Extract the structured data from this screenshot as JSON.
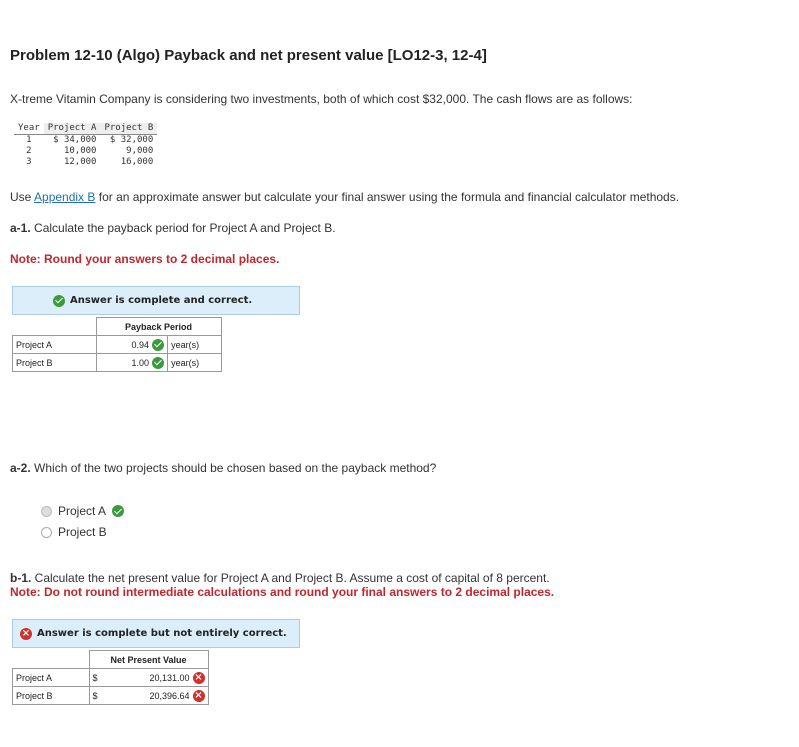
{
  "title": "Problem 12-10 (Algo) Payback and net present value [LO12-3, 12-4]",
  "intro": "X-treme Vitamin Company is considering two investments, both of which cost $32,000. The cash flows are as follows:",
  "cash_flow_table": {
    "headers": [
      "Year",
      "Project A",
      "Project B"
    ],
    "rows": [
      [
        "1",
        "$ 34,000",
        "$ 32,000"
      ],
      [
        "2",
        "10,000",
        "9,000"
      ],
      [
        "3",
        "12,000",
        "16,000"
      ]
    ]
  },
  "instructions": {
    "pre": "Use ",
    "link": "Appendix B",
    "post": " for an approximate answer but calculate your final answer using the formula and financial calculator methods."
  },
  "a1": {
    "label": "a-1.",
    "text": " Calculate the payback period for Project A and Project B.",
    "note": "Note: Round your answers to 2 decimal places.",
    "banner": "Answer is complete and correct.",
    "header": "Payback Period",
    "rows": [
      {
        "label": "Project A",
        "value": "0.94",
        "unit": "year(s)"
      },
      {
        "label": "Project B",
        "value": "1.00",
        "unit": "year(s)"
      }
    ]
  },
  "a2": {
    "label": "a-2.",
    "text": " Which of the two projects should be chosen based on the payback method?",
    "options": [
      "Project A",
      "Project B"
    ],
    "selected": "Project A"
  },
  "b1": {
    "label": "b-1.",
    "text": " Calculate the net present value for Project A and Project B. Assume a cost of capital of 8 percent.",
    "note": "Note: Do not round intermediate calculations and round your final answers to 2 decimal places.",
    "banner": "Answer is complete but not entirely correct.",
    "header": "Net Present Value",
    "currency": "$",
    "rows": [
      {
        "label": "Project A",
        "value": "20,131.00"
      },
      {
        "label": "Project B",
        "value": "20,396.64"
      }
    ]
  }
}
